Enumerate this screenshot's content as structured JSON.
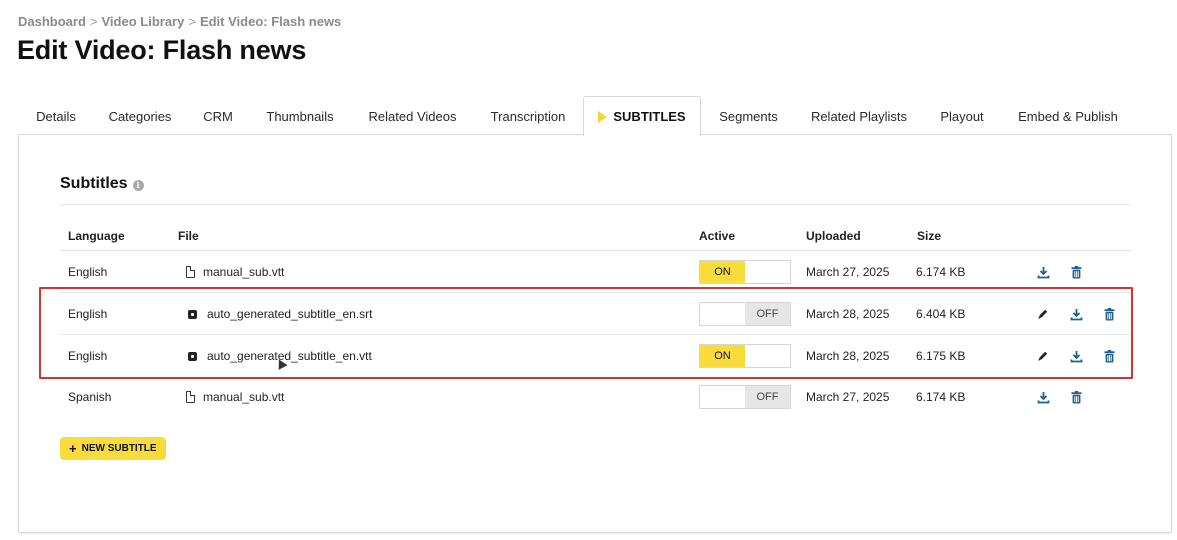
{
  "breadcrumb": {
    "items": [
      "Dashboard",
      "Video Library",
      "Edit Video: Flash news"
    ],
    "separator": ">"
  },
  "page": {
    "title": "Edit Video: Flash news"
  },
  "tabs": [
    {
      "label": "Details"
    },
    {
      "label": "Categories"
    },
    {
      "label": "CRM"
    },
    {
      "label": "Thumbnails"
    },
    {
      "label": "Related Videos"
    },
    {
      "label": "Transcription"
    },
    {
      "label": "SUBTITLES",
      "active": true
    },
    {
      "label": "Segments"
    },
    {
      "label": "Related Playlists"
    },
    {
      "label": "Playout"
    },
    {
      "label": "Embed & Publish"
    }
  ],
  "subtitles": {
    "title": "Subtitles",
    "info_icon": "info-icon",
    "columns": {
      "language": "Language",
      "file": "File",
      "active": "Active",
      "uploaded": "Uploaded",
      "size": "Size"
    },
    "rows": [
      {
        "language": "English",
        "file": "manual_sub.vtt",
        "file_icon": "document-icon",
        "active": "ON",
        "uploaded": "March 27, 2025",
        "size": "6.174 KB",
        "actions": [
          "download-icon",
          "trash-icon"
        ]
      },
      {
        "language": "English",
        "file": "auto_generated_subtitle_en.srt",
        "file_icon": "auto-generated-icon",
        "active": "OFF",
        "uploaded": "March 28, 2025",
        "size": "6.404 KB",
        "actions": [
          "pencil-icon",
          "download-icon",
          "trash-icon"
        ]
      },
      {
        "language": "English",
        "file": "auto_generated_subtitle_en.vtt",
        "file_icon": "auto-generated-icon",
        "active": "ON",
        "uploaded": "March 28, 2025",
        "size": "6.175 KB",
        "actions": [
          "pencil-icon",
          "download-icon",
          "trash-icon"
        ]
      },
      {
        "language": "Spanish",
        "file": "manual_sub.vtt",
        "file_icon": "document-icon",
        "active": "OFF",
        "uploaded": "March 27, 2025",
        "size": "6.174 KB",
        "actions": [
          "download-icon",
          "trash-icon"
        ]
      }
    ],
    "new_button": "NEW SUBTITLE"
  },
  "colors": {
    "accent_yellow": "#f7dc3b",
    "icon_blue": "#1f5f8b",
    "highlight_red": "#d23434"
  }
}
